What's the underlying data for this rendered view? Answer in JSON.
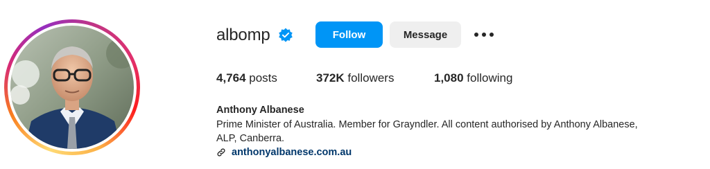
{
  "profile": {
    "username": "albomp",
    "verified": true,
    "full_name": "Anthony Albanese",
    "bio_line_1": "Prime Minister of Australia. Member for Grayndler. All content authorised by Anthony Albanese,",
    "bio_line_2": "ALP, Canberra.",
    "website": "anthonyalbanese.com.au"
  },
  "actions": {
    "follow_label": "Follow",
    "message_label": "Message",
    "more_icon": "more-horizontal-icon"
  },
  "stats": {
    "posts_count": "4,764",
    "posts_label": " posts",
    "followers_count": "372K",
    "followers_label": " followers",
    "following_count": "1,080",
    "following_label": " following"
  },
  "icons": {
    "verified": "verified-badge-icon",
    "link": "link-icon"
  },
  "colors": {
    "follow_button": "#0095f6",
    "message_button": "#efefef",
    "verified_badge": "#0095f6",
    "link_text": "#00376b",
    "text": "#262626"
  }
}
